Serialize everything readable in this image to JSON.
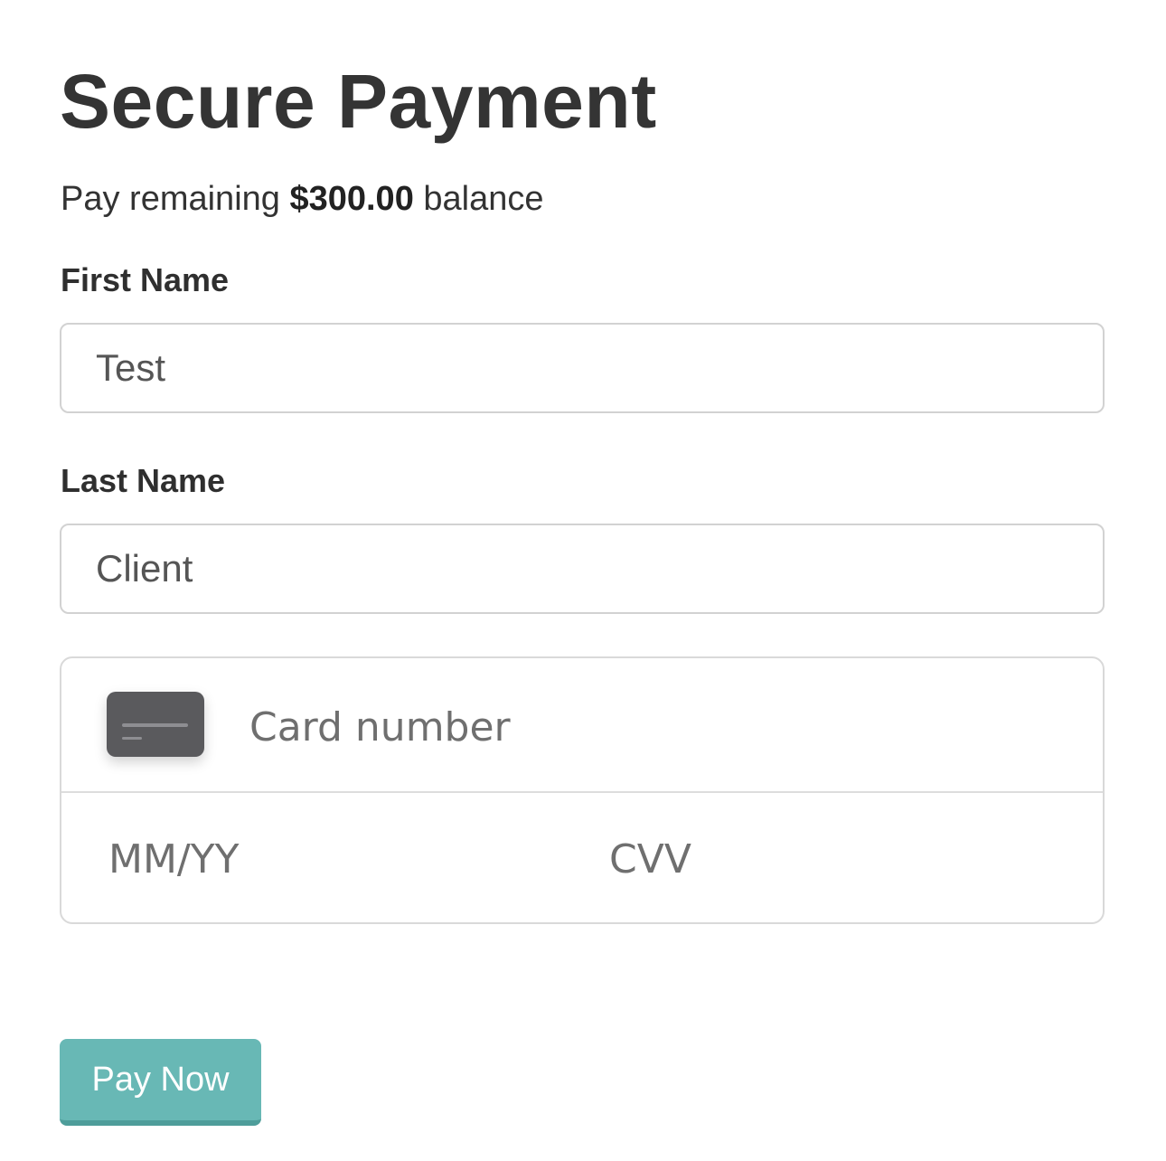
{
  "form": {
    "title": "Secure Payment",
    "subtitle": {
      "prefix": "Pay remaining ",
      "amount": "$300.00",
      "suffix": " balance"
    },
    "first_name": {
      "label": "First Name",
      "value": "Test"
    },
    "last_name": {
      "label": "Last Name",
      "value": "Client"
    },
    "card": {
      "icon": "credit-card-icon",
      "number_placeholder": "Card number",
      "expiry_placeholder": "MM/YY",
      "cvv_placeholder": "CVV"
    },
    "pay_button_label": "Pay Now"
  },
  "colors": {
    "accent": "#68b8b5",
    "text": "#333333",
    "border": "#d2d2d2"
  }
}
